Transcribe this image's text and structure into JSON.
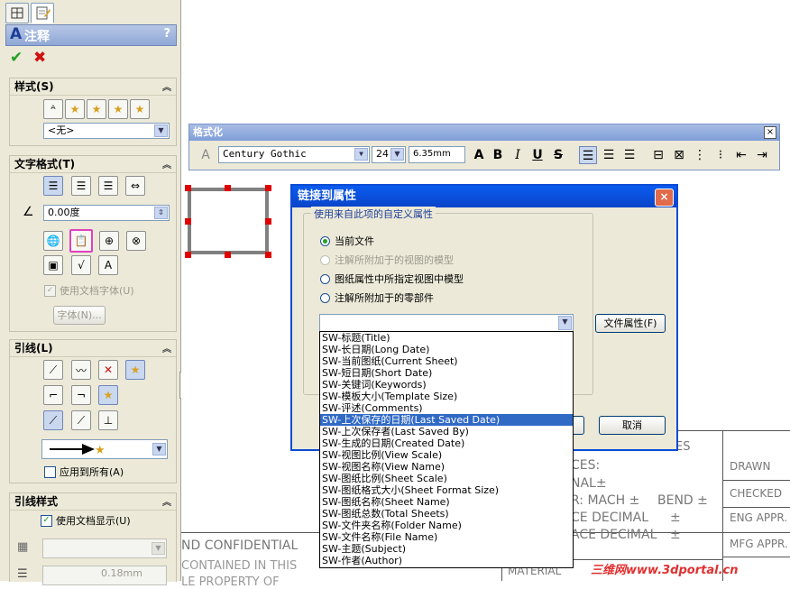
{
  "panel": {
    "title": "注释",
    "help": "?",
    "styles": {
      "header": "样式(S)",
      "value": "<无>"
    },
    "text_format": {
      "header": "文字格式(T)",
      "angle": "0.00度",
      "use_doc_font": "使用文档字体(U)",
      "font_button": "字体(N)..."
    },
    "leader": {
      "header": "引线(L)",
      "apply_all": "应用到所有(A)"
    },
    "leader_style": {
      "header": "引线样式",
      "use_doc_display": "使用文档显示(U)",
      "thickness": "0.18mm"
    }
  },
  "format_bar": {
    "title": "格式化",
    "font": "Century Gothic",
    "size": "24",
    "height": "6.35mm",
    "close": "×"
  },
  "dialog": {
    "title": "链接到属性",
    "group_label": "使用来自此项的自定义属性",
    "options": [
      {
        "label": "当前文件",
        "selected": true,
        "disabled": false
      },
      {
        "label": "注解所附加于的视图的模型",
        "selected": false,
        "disabled": true
      },
      {
        "label": "图纸属性中所指定视图中模型",
        "selected": false,
        "disabled": false
      },
      {
        "label": "注解所附加于的零部件",
        "selected": false,
        "disabled": false
      }
    ],
    "combo_value": "",
    "file_props_button": "文件属性(F)",
    "cancel_button": "取消",
    "close": "×"
  },
  "property_list": [
    "SW-标题(Title)",
    "SW-长日期(Long Date)",
    "SW-当前图纸(Current Sheet)",
    "SW-短日期(Short Date)",
    "SW-关键词(Keywords)",
    "SW-模板大小(Template Size)",
    "SW-评述(Comments)",
    "SW-上次保存的日期(Last Saved Date)",
    "SW-上次保存者(Last Saved By)",
    "SW-生成的日期(Created Date)",
    "SW-视图比例(View Scale)",
    "SW-视图名称(View Name)",
    "SW-图纸比例(Sheet Scale)",
    "SW-图纸格式大小(Sheet Format Size)",
    "SW-图纸名称(Sheet Name)",
    "SW-图纸总数(Total Sheets)",
    "SW-文件夹名称(Folder Name)",
    "SW-文件名称(File Name)",
    "SW-主题(Subject)",
    "SW-作者(Author)"
  ],
  "selected_index": 7,
  "drawing": {
    "es": "ES",
    "ces": "CES:",
    "nal": "NAL±",
    "mach": "R: MACH ±",
    "bend": "BEND ±",
    "ce_decimal": "CE DECIMAL",
    "pm1": "±",
    "ace_decimal": "ACE DECIMAL",
    "pm2": "±",
    "confidential": "ND CONFIDENTIAL",
    "contained": "CONTAINED IN THIS",
    "property": "LE PROPERTY OF",
    "material": "MATERIAL",
    "drawn": "DRAWN",
    "checked": "CHECKED",
    "eng": "ENG APPR.",
    "mfg": "MFG APPR."
  },
  "watermark": "三维网www.3dportal.cn",
  "colors": {
    "selection": "#316ac5",
    "dialog_title": "#0a4bd6",
    "check": "#21a121",
    "cross": "#d01010"
  }
}
